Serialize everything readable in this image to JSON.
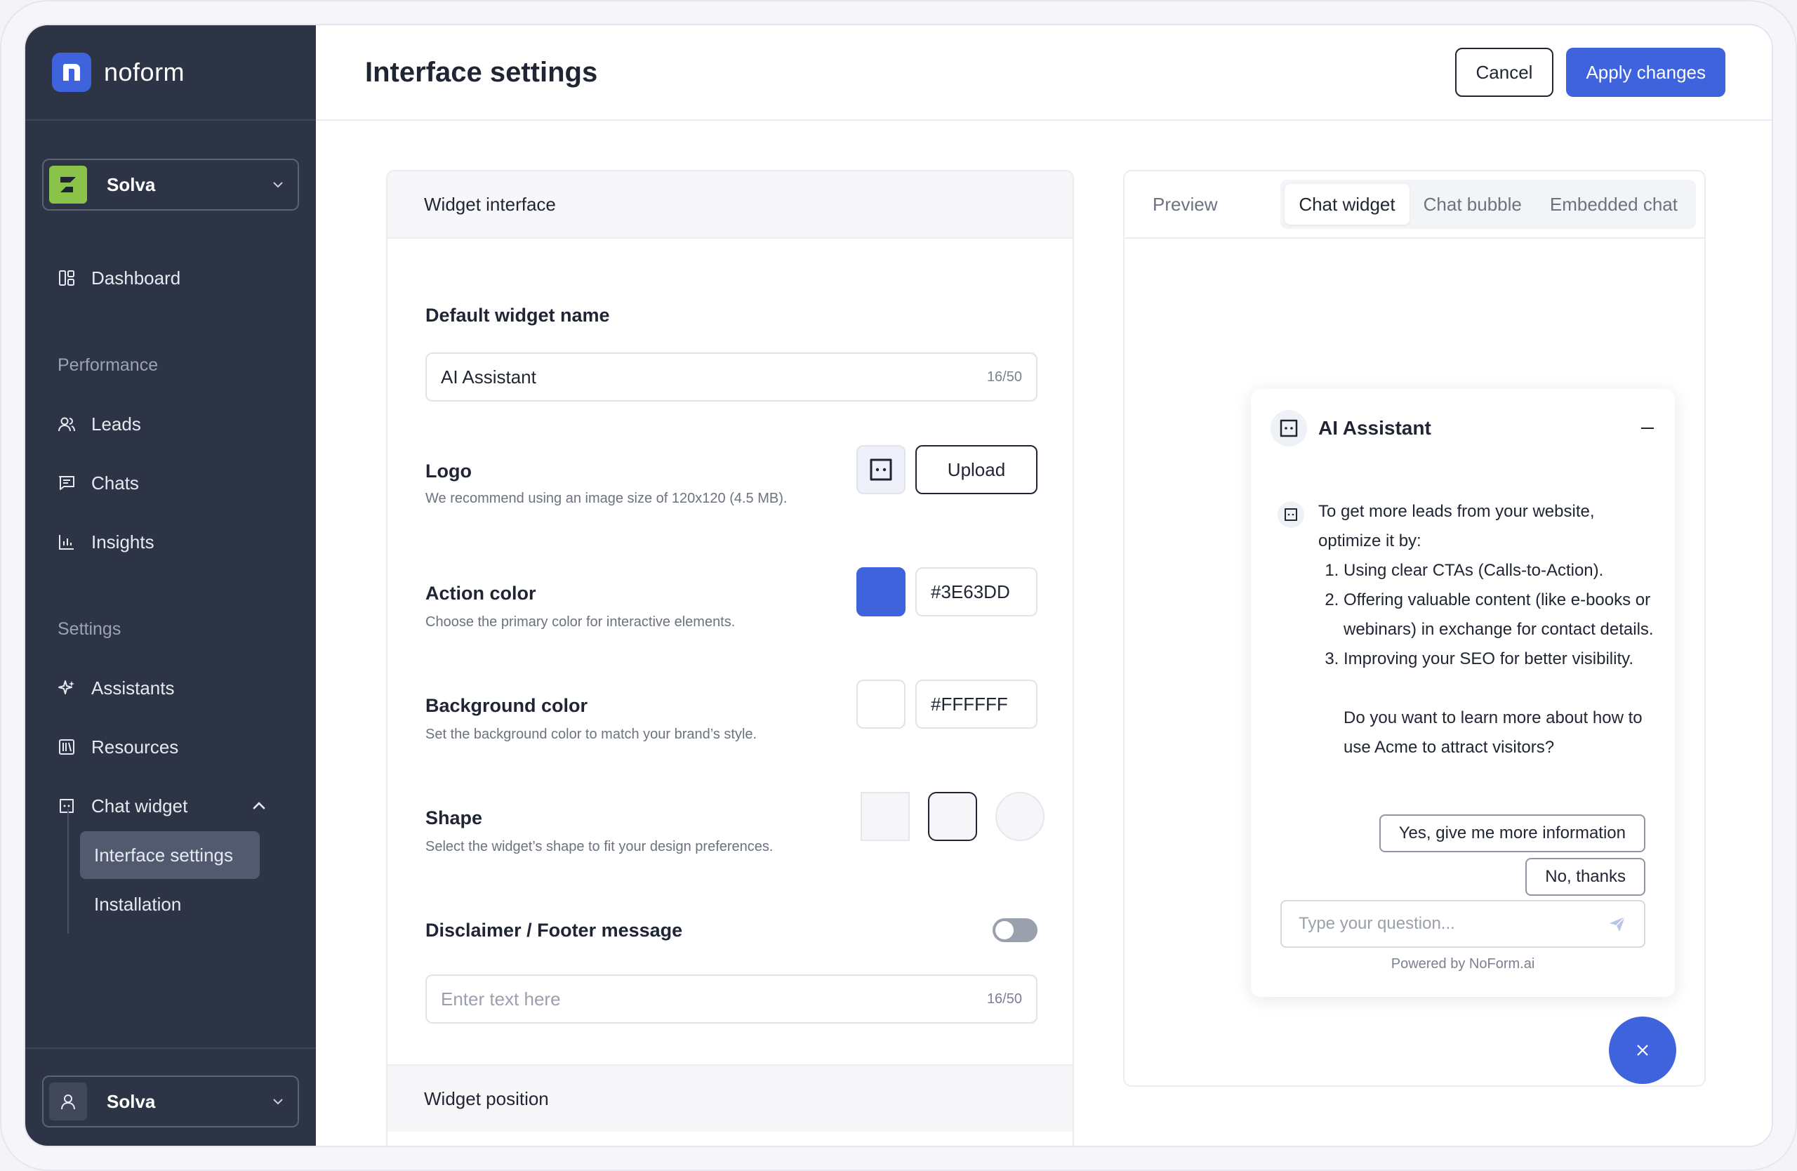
{
  "brand": {
    "name": "noform",
    "accent": "#3E63DD"
  },
  "workspace": {
    "name": "Solva"
  },
  "account": {
    "name": "Solva"
  },
  "sidebar": {
    "dashboard": "Dashboard",
    "performance_heading": "Performance",
    "leads": "Leads",
    "chats": "Chats",
    "insights": "Insights",
    "settings_heading": "Settings",
    "assistants": "Assistants",
    "resources": "Resources",
    "chat_widget": "Chat widget",
    "sub": {
      "interface_settings": "Interface settings",
      "installation": "Installation"
    }
  },
  "header": {
    "title": "Interface settings",
    "cancel": "Cancel",
    "apply": "Apply changes"
  },
  "settings": {
    "section_title": "Widget interface",
    "widget_name": {
      "label": "Default widget name",
      "value": "AI Assistant",
      "counter": "16/50"
    },
    "logo": {
      "label": "Logo",
      "desc": "We recommend using an image size of 120x120 (4.5 MB).",
      "upload": "Upload"
    },
    "action_color": {
      "label": "Action color",
      "desc": "Choose the primary color for interactive elements.",
      "value": "#3E63DD"
    },
    "background_color": {
      "label": "Background color",
      "desc": "Set the background color to match your brand’s style.",
      "value": "#FFFFFF"
    },
    "shape": {
      "label": "Shape",
      "desc": "Select the widget’s shape to fit your design preferences."
    },
    "disclaimer": {
      "label": "Disclaimer / Footer message",
      "placeholder": "Enter text here",
      "counter": "16/50",
      "enabled": false
    },
    "position_title": "Widget position"
  },
  "preview": {
    "label": "Preview",
    "tabs": {
      "chat_widget": "Chat widget",
      "chat_bubble": "Chat bubble",
      "embedded_chat": "Embedded chat"
    },
    "chat": {
      "title": "AI Assistant",
      "intro": "To get more leads from your website, optimize it by:",
      "items": [
        "Using clear CTAs (Calls-to-Action).",
        "Offering valuable content (like e-books or webinars) in exchange for contact details.",
        "Improving your SEO for better visibility."
      ],
      "question": "Do you want to learn more about how to use Acme to attract visitors?",
      "reply_yes": "Yes, give me more information",
      "reply_no": "No, thanks",
      "input_placeholder": "Type your question...",
      "powered": "Powered by NoForm.ai"
    }
  }
}
